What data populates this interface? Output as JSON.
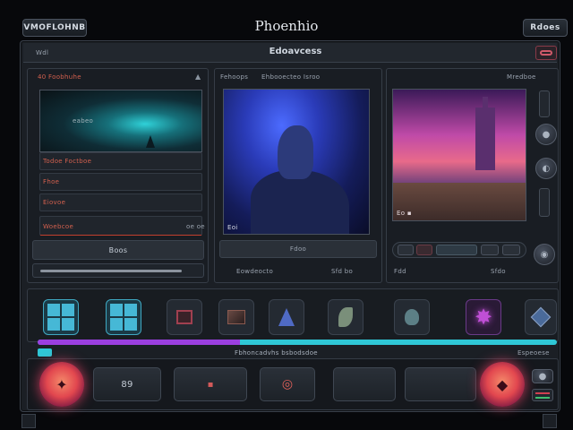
{
  "window": {
    "title": "Phoenhio",
    "left_button": "VMOFLOHNB",
    "right_button": "Rdoes"
  },
  "toolbar": {
    "left_label": "Wdl",
    "center_label": "Edoavcess"
  },
  "left_panel": {
    "header": "40 Foobhuhe",
    "preview_caption": "eabeo",
    "rows": [
      "Todoe Foctboe",
      "Fhoe",
      "Eiovoe",
      "Woebcoe",
      "oe oe"
    ],
    "button_label": "Boos"
  },
  "center_panel": {
    "header": "Fehoops",
    "header_right": "Ehbooecteo Isroo",
    "image_tag": "Eoi",
    "footer_left": "Eowdeocto",
    "footer_right": "Sfd bo",
    "field_label": "Fdoo"
  },
  "right_panel": {
    "header": "Mredboe",
    "image_tag": "Eo ▪",
    "footer_left": "Fdd",
    "footer_right": "Sfdo"
  },
  "tools": [
    {
      "icon": "grid-window-icon",
      "color": "#46b8d6"
    },
    {
      "icon": "grid-window-icon",
      "color": "#46b8d6"
    },
    {
      "icon": "film-icon",
      "color": "#c0485a"
    },
    {
      "icon": "screen-icon",
      "color": "#8a5a50"
    },
    {
      "icon": "wizard-hat-icon",
      "color": "#4f6ac4"
    },
    {
      "icon": "leaf-icon",
      "color": "#7a8f7a"
    },
    {
      "icon": "alien-icon",
      "color": "#5c7f86"
    },
    {
      "icon": "star-burst-icon",
      "color": "#c04fd6"
    },
    {
      "icon": "gem-icon",
      "color": "#4a6a9a"
    }
  ],
  "progress": {
    "value": 0.39,
    "left_label": "▮▮",
    "center_label": "Fbhoncadvhs bsbodsdoe",
    "right_label": "Espeoese"
  },
  "pads": [
    "89",
    "▪",
    "◎",
    "",
    ""
  ],
  "colors": {
    "accent_purple": "#9b3fe0",
    "accent_cyan": "#2fc7d6",
    "accent_red": "#e2474f"
  }
}
